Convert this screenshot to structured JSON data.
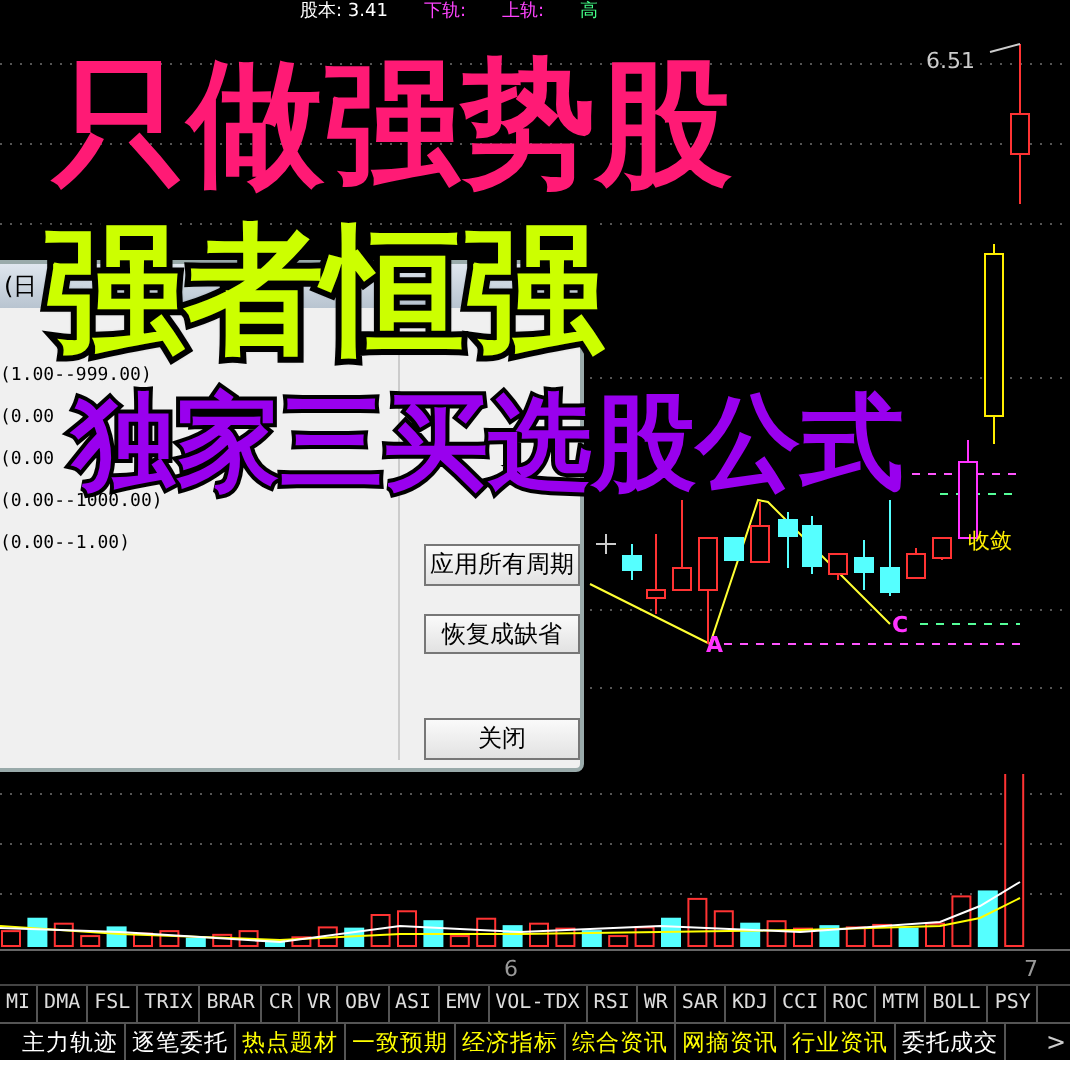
{
  "header": [
    {
      "text": "股本: 3.41",
      "color": "#ffffff"
    },
    {
      "text": "下轨:",
      "color": "#ff44ff"
    },
    {
      "text": "上轨:",
      "color": "#ff44ff"
    },
    {
      "text": "高",
      "color": "#44ff88"
    }
  ],
  "chart_labels": {
    "price": "6.51",
    "point_a": "A",
    "point_c": "C",
    "note": "收敛"
  },
  "volume_axis": [
    "6",
    "7"
  ],
  "headlines": [
    "只做强势股",
    "强者恒强",
    "独家三买选股公式"
  ],
  "dialog": {
    "title": "(日",
    "params": [
      "(1.00--999.00)",
      "(0.00",
      "(0.00",
      "(0.00--1000.00)",
      "(0.00--1.00)"
    ],
    "buttons": [
      "应用所有周期",
      "恢复成缺省",
      "关闭"
    ]
  },
  "indicator_tabs": [
    "MI",
    "DMA",
    "FSL",
    "TRIX",
    "BRAR",
    "CR",
    "VR",
    "OBV",
    "ASI",
    "EMV",
    "VOL-TDX",
    "RSI",
    "WR",
    "SAR",
    "KDJ",
    "CCI",
    "ROC",
    "MTM",
    "BOLL",
    "PSY"
  ],
  "info_tabs": [
    {
      "label": "主力轨迹",
      "highlighted": false
    },
    {
      "label": "逐笔委托",
      "highlighted": false
    },
    {
      "label": "热点题材",
      "highlighted": true
    },
    {
      "label": "一致预期",
      "highlighted": true
    },
    {
      "label": "经济指标",
      "highlighted": true
    },
    {
      "label": "综合资讯",
      "highlighted": true
    },
    {
      "label": "网摘资讯",
      "highlighted": true
    },
    {
      "label": "行业资讯",
      "highlighted": true
    },
    {
      "label": "委托成交",
      "highlighted": false
    }
  ],
  "scroll_arrow": ">"
}
